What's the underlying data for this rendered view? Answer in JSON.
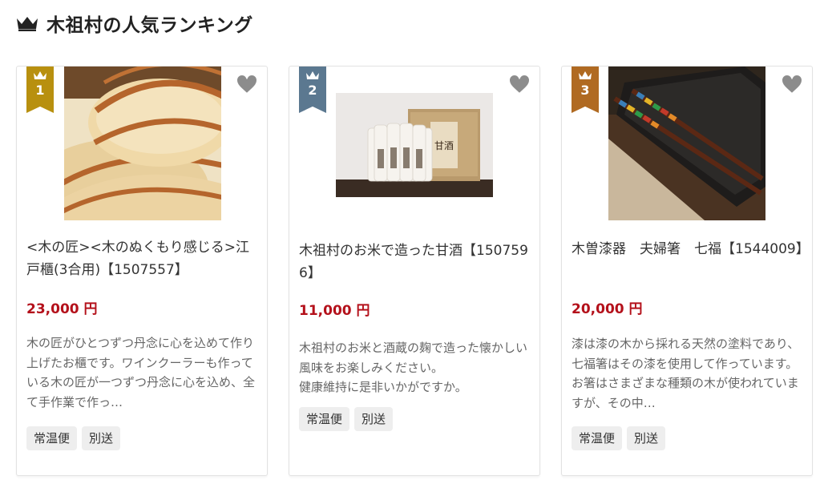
{
  "section": {
    "title": "木祖村の人気ランキング",
    "icon": "crown-icon"
  },
  "cards": [
    {
      "rank": "1",
      "badge_color": "#b8900f",
      "title": "<木の匠><木のぬくもり感じる>江戸櫃(3合用)【1507557】",
      "price": "23,000 円",
      "description": "木の匠がひとつずつ丹念に心を込めて作り上げたお櫃です。ワインクーラーも作っている木の匠が一つずつ丹念に心を込め、全て手作業で作っ…",
      "tags": [
        "常温便",
        "別送"
      ]
    },
    {
      "rank": "2",
      "badge_color": "#5b7890",
      "title": "木祖村のお米で造った甘酒【1507596】",
      "price": "11,000 円",
      "description": "木祖村のお米と酒蔵の麹で造った懐かしい風味をお楽しみください。\n健康維持に是非いかがですか。",
      "tags": [
        "常温便",
        "別送"
      ]
    },
    {
      "rank": "3",
      "badge_color": "#b06a22",
      "title": "木曽漆器　夫婦箸　七福【1544009】",
      "price": "20,000 円",
      "description": "漆は漆の木から採れる天然の塗料であり、七福箸はその漆を使用して作っています。お箸はさまざまな種類の木が使われていますが、その中…",
      "tags": [
        "常温便",
        "別送"
      ]
    }
  ],
  "colors": {
    "price": "#b4111b",
    "heart": "#8c8c8c",
    "tag_bg": "#eeeeee"
  }
}
